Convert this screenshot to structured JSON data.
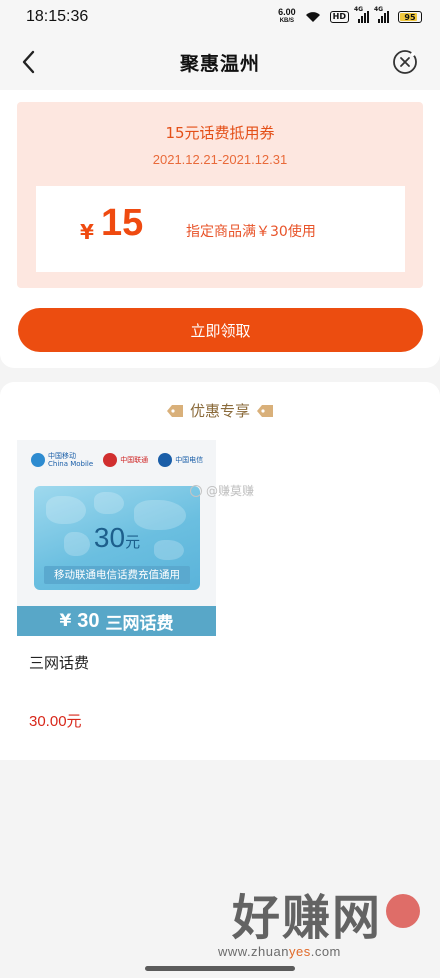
{
  "status_bar": {
    "time": "18:15:36",
    "net_speed_value": "6.00",
    "net_speed_unit": "KB/S",
    "hd_label": "HD",
    "signal1_label": "4G",
    "signal2_label": "4G",
    "battery_level": "95"
  },
  "nav": {
    "title": "聚惠温州",
    "back_icon": "chevron-left-icon",
    "close_icon": "close-circle-icon"
  },
  "coupon": {
    "title": "15元话费抵用券",
    "validity": "2021.12.21-2021.12.31",
    "currency": "¥",
    "amount": "15",
    "condition": "指定商品满￥30使用",
    "claim_label": "立即领取"
  },
  "deals": {
    "header": "优惠专享",
    "products": [
      {
        "carriers": [
          "中国移动",
          "China Mobile",
          "中国联通",
          "中国电信"
        ],
        "card_value": "30",
        "card_unit": "元",
        "card_strip": "移动联通电信话费充值通用",
        "banner_currency": "¥",
        "banner_price": "30",
        "banner_text": "三网话费",
        "name": "三网话费",
        "price": "30.00元"
      }
    ]
  },
  "watermarks": {
    "weibo_handle": "@赚莫赚",
    "site_name": "好赚网",
    "site_url_prefix": "www.zhuan",
    "site_url_accent": "yes",
    "site_url_suffix": ".com"
  },
  "colors": {
    "accent": "#ec4d10",
    "coupon_bg": "#fde7e0",
    "price_red": "#d8271a",
    "deal_gold": "#c8a066"
  }
}
